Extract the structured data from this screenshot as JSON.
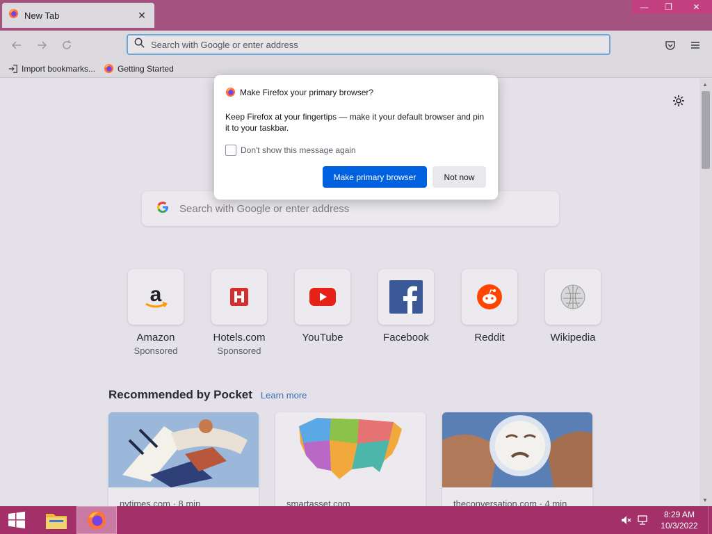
{
  "window": {
    "tab_title": "New Tab",
    "controls": {
      "minimize": "—",
      "restore": "❐",
      "close": "✕"
    }
  },
  "toolbar": {
    "address_placeholder": "Search with Google or enter address"
  },
  "bookmarks": [
    {
      "label": "Import bookmarks...",
      "icon": "import-icon"
    },
    {
      "label": "Getting Started",
      "icon": "firefox-icon"
    }
  ],
  "newtab": {
    "search_placeholder": "Search with Google or enter address",
    "top_sites": [
      {
        "label": "Amazon",
        "sub": "Sponsored"
      },
      {
        "label": "Hotels.com",
        "sub": "Sponsored"
      },
      {
        "label": "YouTube",
        "sub": ""
      },
      {
        "label": "Facebook",
        "sub": ""
      },
      {
        "label": "Reddit",
        "sub": ""
      },
      {
        "label": "Wikipedia",
        "sub": ""
      }
    ],
    "pocket": {
      "title": "Recommended by Pocket",
      "learn_more": "Learn more",
      "cards": [
        {
          "source": "nytimes.com · 8 min"
        },
        {
          "source": "smartasset.com"
        },
        {
          "source": "theconversation.com · 4 min"
        }
      ]
    }
  },
  "dialog": {
    "title": "Make Firefox your primary browser?",
    "body": "Keep Firefox at your fingertips — make it your default browser and pin it to your taskbar.",
    "checkbox_label": "Don't show this message again",
    "checkbox_checked": false,
    "primary_button": "Make primary browser",
    "secondary_button": "Not now"
  },
  "taskbar": {
    "time": "8:29 AM",
    "date": "10/3/2022"
  },
  "colors": {
    "accent": "#0061e0",
    "titlebar": "#a4527f",
    "taskbar": "#a4306a"
  }
}
